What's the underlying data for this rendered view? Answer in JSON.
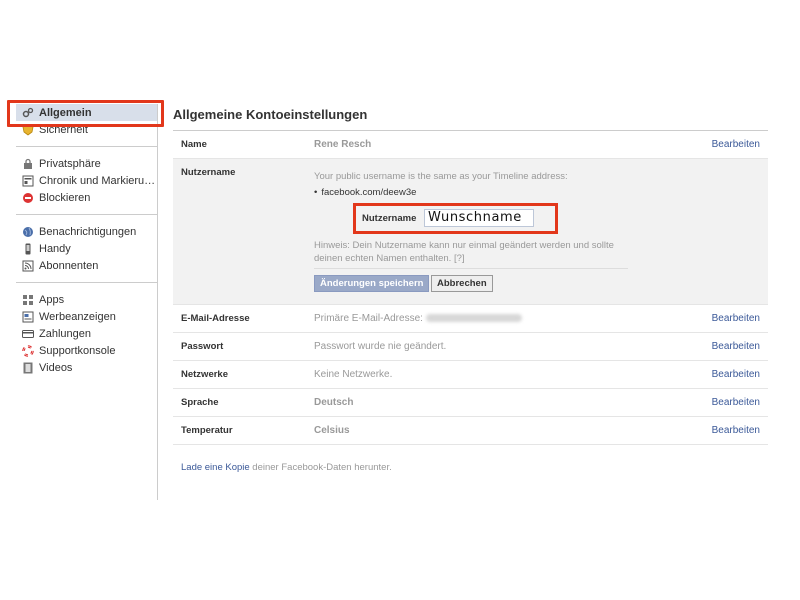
{
  "sidebar": {
    "groups": [
      [
        {
          "label": "Allgemein",
          "icon": "gears-icon",
          "active": true
        },
        {
          "label": "Sicherheit",
          "icon": "shield-icon"
        }
      ],
      [
        {
          "label": "Privatsphäre",
          "icon": "lock-icon"
        },
        {
          "label": "Chronik und Markierung...",
          "icon": "timeline-icon"
        },
        {
          "label": "Blockieren",
          "icon": "block-icon"
        }
      ],
      [
        {
          "label": "Benachrichtigungen",
          "icon": "globe-icon"
        },
        {
          "label": "Handy",
          "icon": "phone-icon"
        },
        {
          "label": "Abonnenten",
          "icon": "rss-icon"
        }
      ],
      [
        {
          "label": "Apps",
          "icon": "apps-icon"
        },
        {
          "label": "Werbeanzeigen",
          "icon": "ads-icon"
        },
        {
          "label": "Zahlungen",
          "icon": "card-icon"
        },
        {
          "label": "Supportkonsole",
          "icon": "lifebuoy-icon"
        },
        {
          "label": "Videos",
          "icon": "film-icon"
        }
      ]
    ]
  },
  "main": {
    "title": "Allgemeine Kontoeinstellungen",
    "edit_label": "Bearbeiten",
    "name_row": {
      "label": "Name",
      "value": "Rene Resch"
    },
    "username": {
      "label": "Nutzername",
      "hint": "Your public username is the same as your Timeline address:",
      "url": "facebook.com/deew3e",
      "field_label": "Nutzername",
      "field_value": "Wunschname",
      "note": "Hinweis: Dein Nutzername kann nur einmal geändert werden und sollte deinen echten Namen enthalten. [?]",
      "save_label": "Änderungen speichern",
      "cancel_label": "Abbrechen"
    },
    "rows": [
      {
        "label": "E-Mail-Adresse",
        "value": "Primäre E-Mail-Adresse:"
      },
      {
        "label": "Passwort",
        "value": "Passwort wurde nie geändert."
      },
      {
        "label": "Netzwerke",
        "value": "Keine Netzwerke."
      },
      {
        "label": "Sprache",
        "value": "Deutsch"
      },
      {
        "label": "Temperatur",
        "value": "Celsius"
      }
    ],
    "footer": {
      "link": "Lade eine Kopie",
      "rest": " deiner Facebook-Daten herunter."
    }
  },
  "colors": {
    "link": "#3b5998",
    "highlight": "#e2371b",
    "active_bg": "#d8dfea"
  }
}
